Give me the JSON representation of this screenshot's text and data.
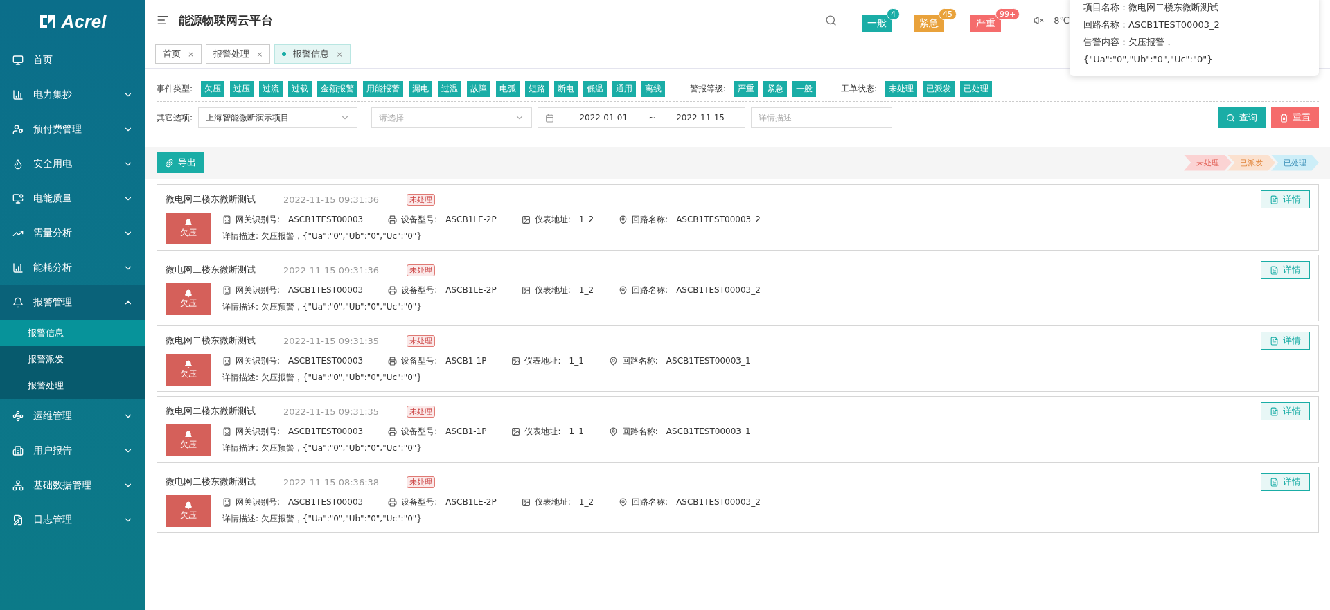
{
  "logo": {
    "text": "Acrel"
  },
  "sidebar": {
    "items": [
      {
        "label": "首页",
        "expandable": false,
        "expanded": false
      },
      {
        "label": "电力集抄",
        "expandable": true,
        "expanded": false
      },
      {
        "label": "预付费管理",
        "expandable": true,
        "expanded": false
      },
      {
        "label": "安全用电",
        "expandable": true,
        "expanded": false
      },
      {
        "label": "电能质量",
        "expandable": true,
        "expanded": false
      },
      {
        "label": "需量分析",
        "expandable": true,
        "expanded": false
      },
      {
        "label": "能耗分析",
        "expandable": true,
        "expanded": false
      },
      {
        "label": "报警管理",
        "expandable": true,
        "expanded": true,
        "children": [
          {
            "label": "报警信息",
            "selected": true
          },
          {
            "label": "报警派发",
            "selected": false
          },
          {
            "label": "报警处理",
            "selected": false
          }
        ]
      },
      {
        "label": "运维管理",
        "expandable": true,
        "expanded": false
      },
      {
        "label": "用户报告",
        "expandable": true,
        "expanded": false
      },
      {
        "label": "基础数据管理",
        "expandable": true,
        "expanded": false
      },
      {
        "label": "日志管理",
        "expandable": true,
        "expanded": false
      }
    ]
  },
  "header": {
    "title": "能源物联网云平台",
    "alerts": [
      {
        "label": "一般",
        "count": "4",
        "color": "#1aada6"
      },
      {
        "label": "紧急",
        "count": "45",
        "color": "#e9a23b"
      },
      {
        "label": "严重",
        "count": "99+",
        "color": "#f56c6c"
      }
    ],
    "weather": "8℃"
  },
  "tooltip": {
    "lines": [
      {
        "label": "项目名称：",
        "value": "微电网二楼东微断测试"
      },
      {
        "label": "回路名称：",
        "value": "ASCB1TEST00003_2"
      },
      {
        "label": "告警内容：",
        "value": "欠压报警，"
      },
      {
        "value": "{\"Ua\":\"0\",\"Ub\":\"0\",\"Uc\":\"0\"}"
      }
    ]
  },
  "tabs": [
    {
      "label": "首页",
      "close": "×",
      "selected": false
    },
    {
      "label": "报警处理",
      "close": "×",
      "selected": false
    },
    {
      "label": "报警信息",
      "close": "×",
      "selected": true
    }
  ],
  "filters": {
    "groups": [
      {
        "label": "事件类型:",
        "tags": [
          "欠压",
          "过压",
          "过流",
          "过载",
          "金额报警",
          "用能报警",
          "漏电",
          "过温",
          "故障",
          "电弧",
          "短路",
          "断电",
          "低温",
          "通用",
          "离线"
        ]
      },
      {
        "label": "警报等级:",
        "tags": [
          "严重",
          "紧急",
          "一般"
        ]
      },
      {
        "label": "工单状态:",
        "tags": [
          "未处理",
          "已派发",
          "已处理"
        ]
      }
    ],
    "other_label": "其它选项:",
    "project": "上海智能微断演示项目",
    "dash": "-",
    "select_placeholder": "请选择",
    "date_from": "2022-01-01",
    "date_sep": "~",
    "date_to": "2022-11-15",
    "detail_placeholder": "详情描述",
    "query": "查询",
    "reset": "重置"
  },
  "export": "导出",
  "legend": [
    {
      "label": "未处理",
      "color": "#fbd3d3"
    },
    {
      "label": "已派发",
      "color": "#fbe1cf"
    },
    {
      "label": "已处理",
      "color": "#cdeef8"
    }
  ],
  "cards": [
    {
      "title": "微电网二楼东微断测试",
      "time": "2022-11-15 09:31:36",
      "status": "未处理",
      "type": "欠压",
      "fields": [
        {
          "kind": "gateway",
          "label": "网关识别号:",
          "value": "ASCB1TEST00003"
        },
        {
          "kind": "device",
          "label": "设备型号:",
          "value": "ASCB1LE-2P"
        },
        {
          "kind": "meter",
          "label": "仪表地址:",
          "value": "1_2"
        },
        {
          "kind": "circuit",
          "label": "回路名称:",
          "value": "ASCB1TEST00003_2"
        }
      ],
      "description": "详情描述: 欠压报警，{\"Ua\":\"0\",\"Ub\":\"0\",\"Uc\":\"0\"}",
      "button": "详情"
    },
    {
      "title": "微电网二楼东微断测试",
      "time": "2022-11-15 09:31:36",
      "status": "未处理",
      "type": "欠压",
      "fields": [
        {
          "kind": "gateway",
          "label": "网关识别号:",
          "value": "ASCB1TEST00003"
        },
        {
          "kind": "device",
          "label": "设备型号:",
          "value": "ASCB1LE-2P"
        },
        {
          "kind": "meter",
          "label": "仪表地址:",
          "value": "1_2"
        },
        {
          "kind": "circuit",
          "label": "回路名称:",
          "value": "ASCB1TEST00003_2"
        }
      ],
      "description": "详情描述: 欠压预警，{\"Ua\":\"0\",\"Ub\":\"0\",\"Uc\":\"0\"}",
      "button": "详情"
    },
    {
      "title": "微电网二楼东微断测试",
      "time": "2022-11-15 09:31:35",
      "status": "未处理",
      "type": "欠压",
      "fields": [
        {
          "kind": "gateway",
          "label": "网关识别号:",
          "value": "ASCB1TEST00003"
        },
        {
          "kind": "device",
          "label": "设备型号:",
          "value": "ASCB1-1P"
        },
        {
          "kind": "meter",
          "label": "仪表地址:",
          "value": "1_1"
        },
        {
          "kind": "circuit",
          "label": "回路名称:",
          "value": "ASCB1TEST00003_1"
        }
      ],
      "description": "详情描述: 欠压报警，{\"Ua\":\"0\",\"Ub\":\"0\",\"Uc\":\"0\"}",
      "button": "详情"
    },
    {
      "title": "微电网二楼东微断测试",
      "time": "2022-11-15 09:31:35",
      "status": "未处理",
      "type": "欠压",
      "fields": [
        {
          "kind": "gateway",
          "label": "网关识别号:",
          "value": "ASCB1TEST00003"
        },
        {
          "kind": "device",
          "label": "设备型号:",
          "value": "ASCB1-1P"
        },
        {
          "kind": "meter",
          "label": "仪表地址:",
          "value": "1_1"
        },
        {
          "kind": "circuit",
          "label": "回路名称:",
          "value": "ASCB1TEST00003_1"
        }
      ],
      "description": "详情描述: 欠压预警，{\"Ua\":\"0\",\"Ub\":\"0\",\"Uc\":\"0\"}",
      "button": "详情"
    },
    {
      "title": "微电网二楼东微断测试",
      "time": "2022-11-15 08:36:38",
      "status": "未处理",
      "type": "欠压",
      "fields": [
        {
          "kind": "gateway",
          "label": "网关识别号:",
          "value": "ASCB1TEST00003"
        },
        {
          "kind": "device",
          "label": "设备型号:",
          "value": "ASCB1LE-2P"
        },
        {
          "kind": "meter",
          "label": "仪表地址:",
          "value": "1_2"
        },
        {
          "kind": "circuit",
          "label": "回路名称:",
          "value": "ASCB1TEST00003_2"
        }
      ],
      "description": "详情描述: 欠压报警，{\"Ua\":\"0\",\"Ub\":\"0\",\"Uc\":\"0\"}",
      "button": "详情"
    }
  ]
}
